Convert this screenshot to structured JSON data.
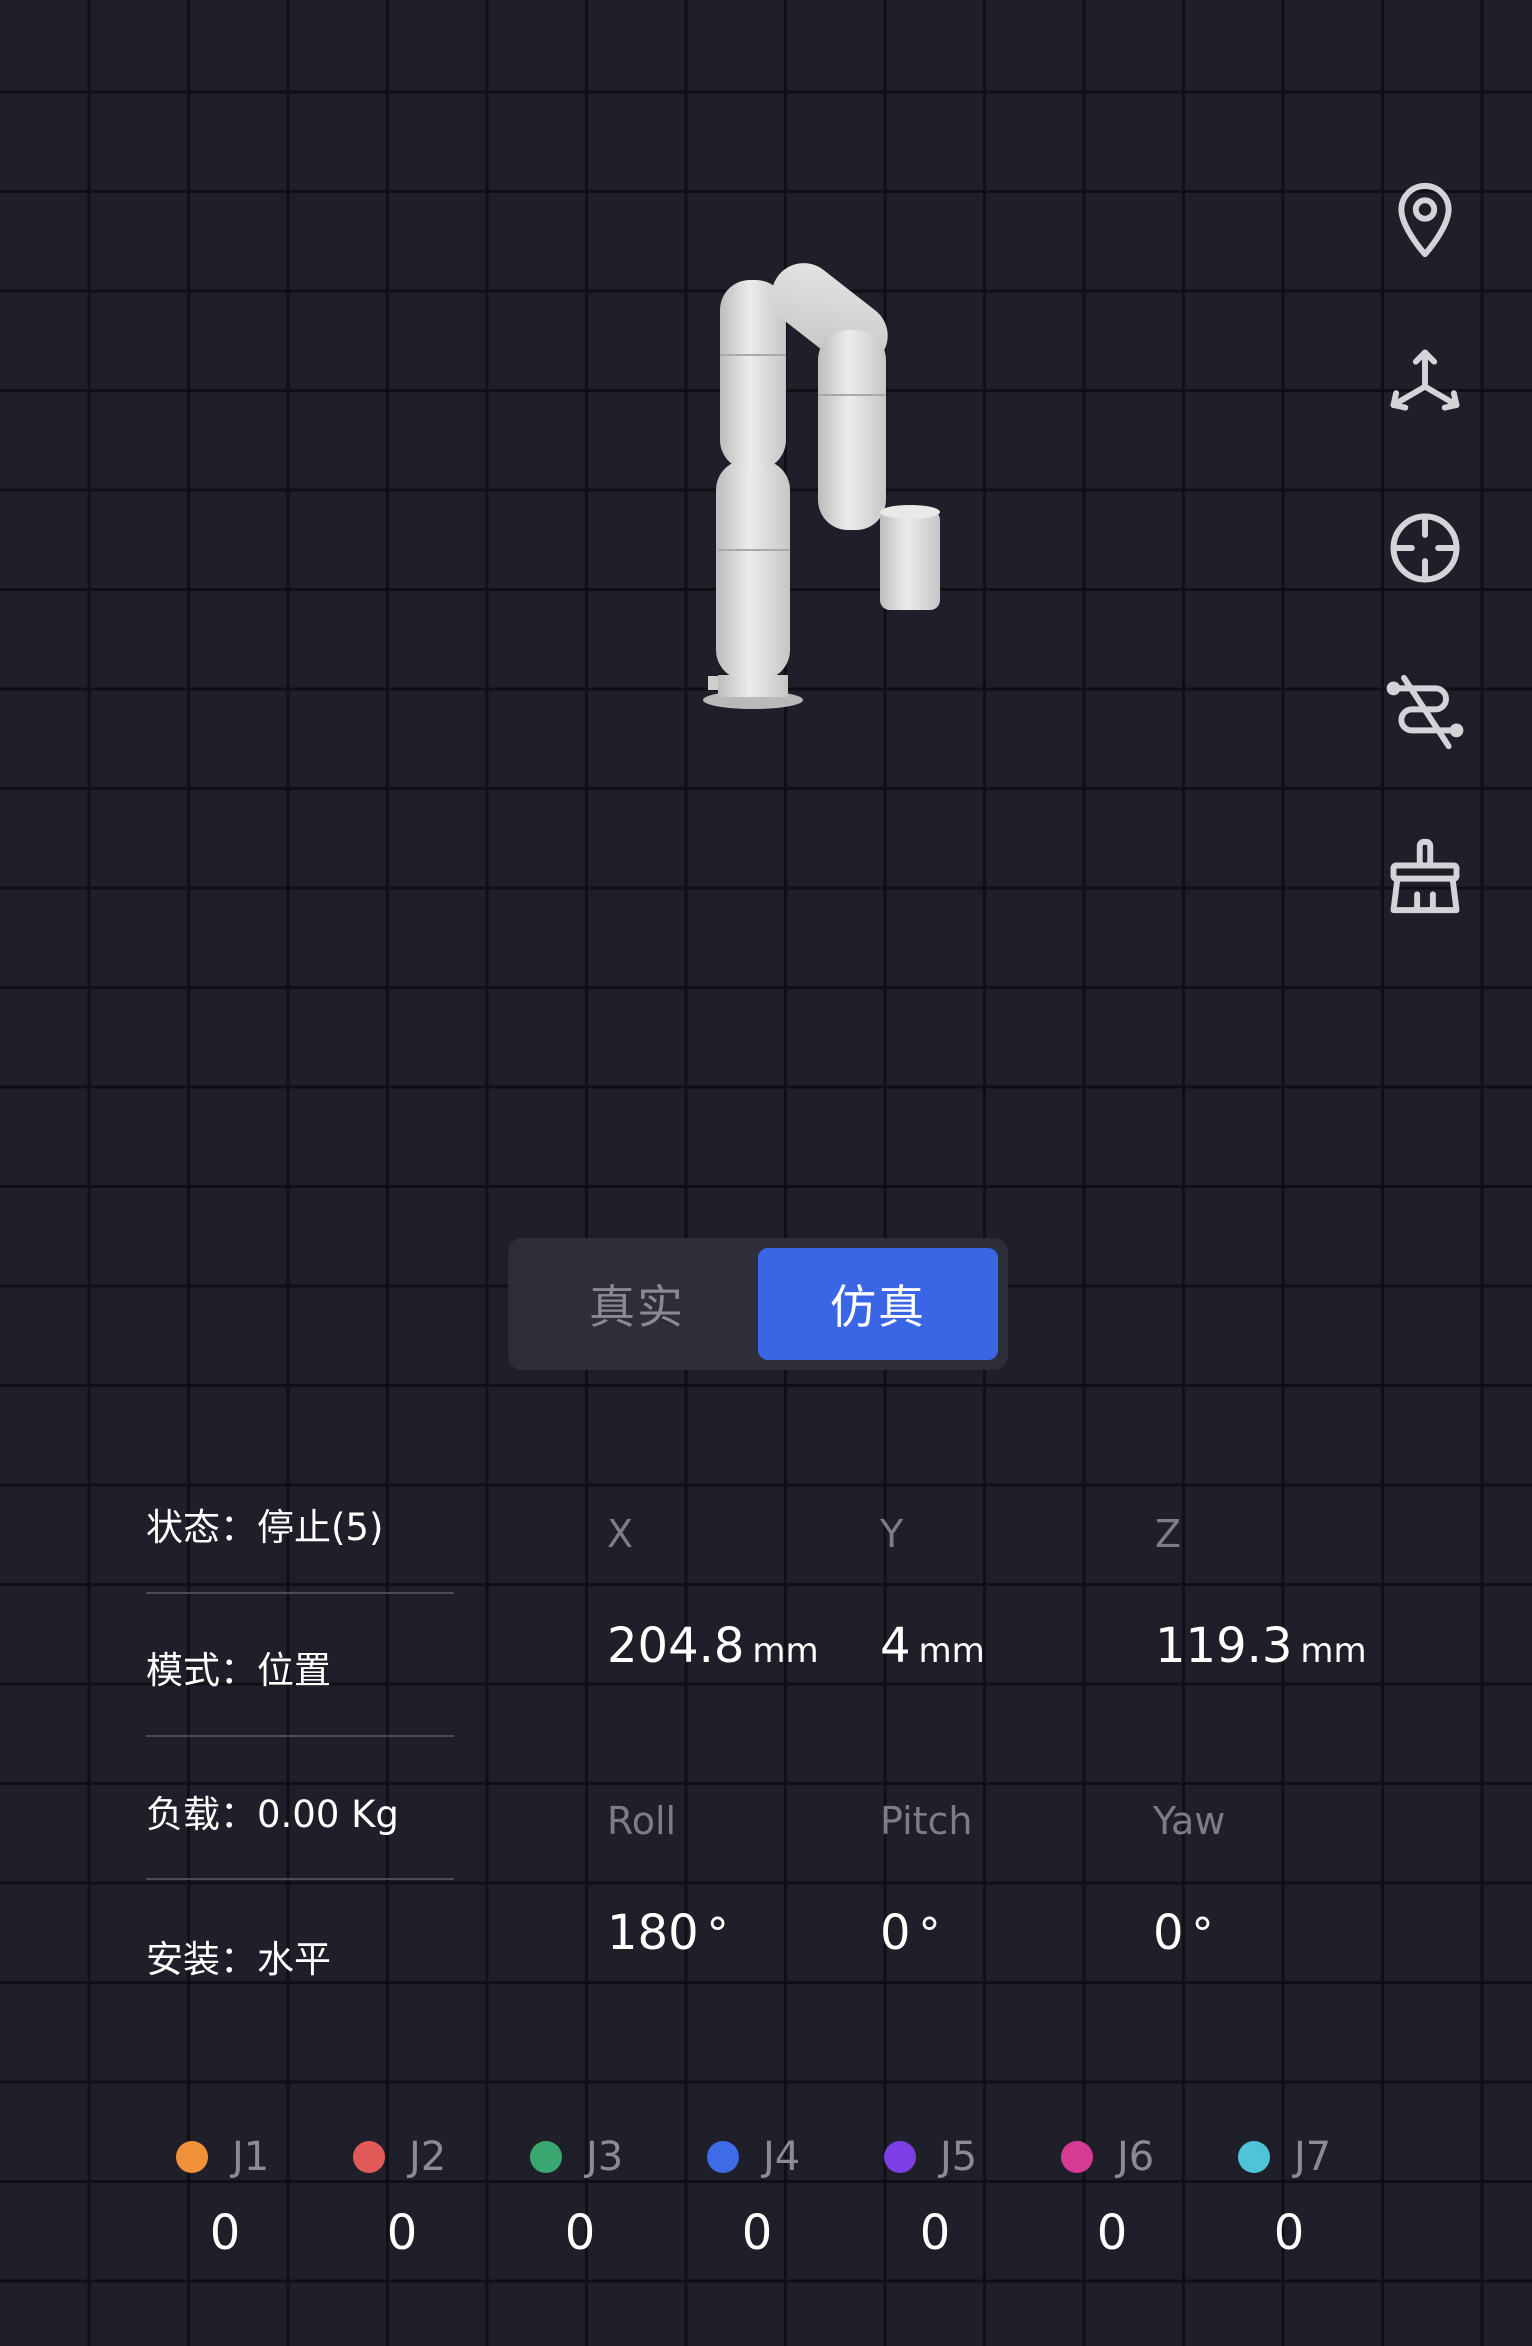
{
  "mode_toggle": {
    "real_label": "真实",
    "sim_label": "仿真",
    "selected": "仿真"
  },
  "toolbar": {
    "icons": [
      "location-pin-icon",
      "axes-3d-icon",
      "crosshair-icon",
      "path-disable-icon",
      "brush-clear-icon"
    ]
  },
  "status": {
    "state": "状态：停止(5)",
    "mode": "模式：位置",
    "payload": "负载：0.00 Kg",
    "mount": "安装：水平"
  },
  "position": {
    "x": {
      "label": "X",
      "value": "204.8",
      "unit": "mm"
    },
    "y": {
      "label": "Y",
      "value": "4",
      "unit": "mm"
    },
    "z": {
      "label": "Z",
      "value": "119.3",
      "unit": "mm"
    }
  },
  "orientation": {
    "roll": {
      "label": "Roll",
      "value": "180",
      "unit": "°"
    },
    "pitch": {
      "label": "Pitch",
      "value": "0",
      "unit": "°"
    },
    "yaw": {
      "label": "Yaw",
      "value": "0",
      "unit": "°"
    }
  },
  "joints": [
    {
      "label": "J1",
      "value": "0",
      "color": "#f0913a"
    },
    {
      "label": "J2",
      "value": "0",
      "color": "#e25a57"
    },
    {
      "label": "J3",
      "value": "0",
      "color": "#3aa770"
    },
    {
      "label": "J4",
      "value": "0",
      "color": "#3e6be6"
    },
    {
      "label": "J5",
      "value": "0",
      "color": "#7b3fe4"
    },
    {
      "label": "J6",
      "value": "0",
      "color": "#d63a92"
    },
    {
      "label": "J7",
      "value": "0",
      "color": "#4fc3d8"
    }
  ]
}
